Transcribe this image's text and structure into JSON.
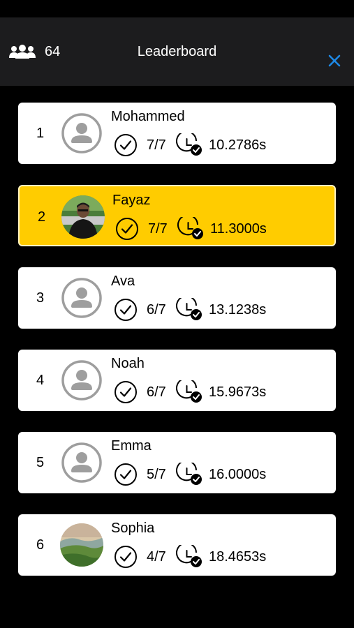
{
  "header": {
    "participants_count": "64",
    "title": "Leaderboard",
    "close_icon": "close-icon",
    "accent_color": "#1e88e5"
  },
  "colors": {
    "highlight": "#ffcc00",
    "background": "#000000",
    "header_bg": "#1c1c1e"
  },
  "rows": [
    {
      "rank": "1",
      "name": "Mohammed",
      "score": "7/7",
      "time": "10.2786s",
      "avatar": "default-avatar-icon",
      "highlight": false
    },
    {
      "rank": "2",
      "name": "Fayaz",
      "score": "7/7",
      "time": "11.3000s",
      "avatar": "user-photo",
      "highlight": true
    },
    {
      "rank": "3",
      "name": "Ava",
      "score": "6/7",
      "time": "13.1238s",
      "avatar": "default-avatar-icon",
      "highlight": false
    },
    {
      "rank": "4",
      "name": "Noah",
      "score": "6/7",
      "time": "15.9673s",
      "avatar": "default-avatar-icon",
      "highlight": false
    },
    {
      "rank": "5",
      "name": "Emma",
      "score": "5/7",
      "time": "16.0000s",
      "avatar": "default-avatar-icon",
      "highlight": false
    },
    {
      "rank": "6",
      "name": "Sophia",
      "score": "4/7",
      "time": "18.4653s",
      "avatar": "landscape-photo",
      "highlight": false
    }
  ]
}
